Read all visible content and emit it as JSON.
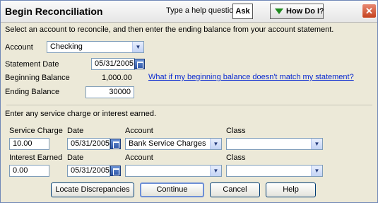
{
  "window": {
    "title": "Begin Reconciliation",
    "help_question": "Type a help question",
    "ask_label": "Ask",
    "how_do_i_label": "How Do I?",
    "close_glyph": "✕"
  },
  "instruction": "Select an account to reconcile, and then enter the ending balance from your account statement.",
  "account": {
    "label": "Account",
    "value": "Checking"
  },
  "statement_date": {
    "label": "Statement Date",
    "value": "05/31/2005"
  },
  "beginning_balance": {
    "label": "Beginning Balance",
    "value": "1,000.00"
  },
  "mismatch_link": "What if my beginning balance doesn't match my statement?",
  "ending_balance": {
    "label": "Ending Balance",
    "value": "30000"
  },
  "service_section": "Enter any service charge or interest earned.",
  "service_charge": {
    "label": "Service Charge",
    "amount": "10.00",
    "date_label": "Date",
    "date": "05/31/2005",
    "account_label": "Account",
    "account": "Bank Service Charges",
    "class_label": "Class",
    "class": ""
  },
  "interest": {
    "label": "Interest Earned",
    "amount": "0.00",
    "date_label": "Date",
    "date": "05/31/2005",
    "account_label": "Account",
    "account": "",
    "class_label": "Class",
    "class": ""
  },
  "buttons": {
    "locate": "Locate Discrepancies",
    "continue": "Continue",
    "cancel": "Cancel",
    "help": "Help"
  },
  "colors": {
    "link": "#0b2bd0",
    "dialog_bg": "#ece9d8",
    "close_red": "#c4411e",
    "how_do_i_green": "#1f8a1f"
  }
}
